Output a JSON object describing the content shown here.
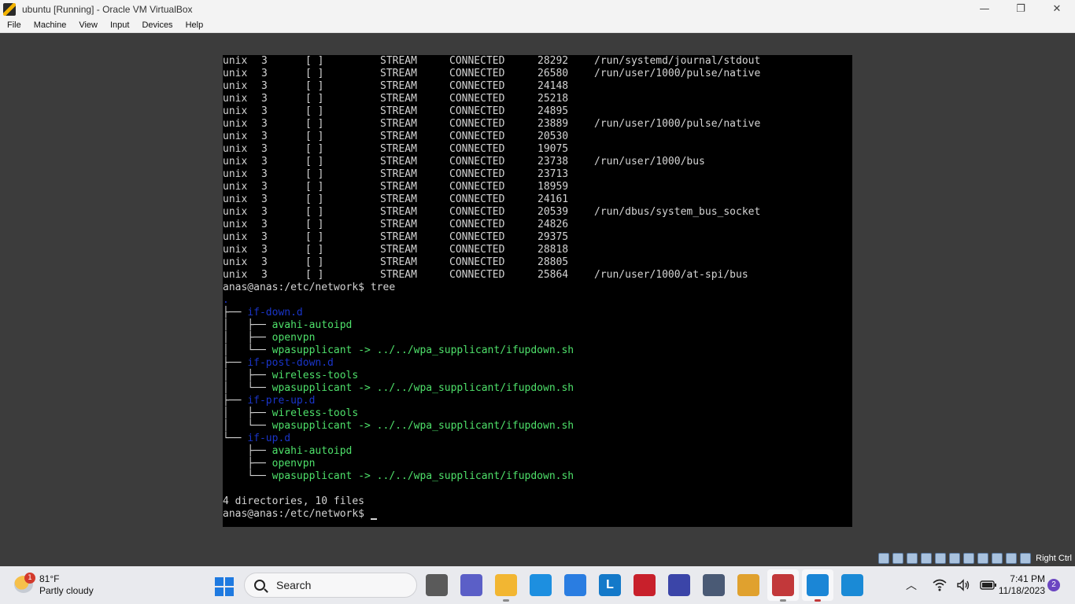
{
  "window": {
    "title": "ubuntu [Running] - Oracle VM VirtualBox",
    "minimize_glyph": "—",
    "maximize_glyph": "❐",
    "close_glyph": "✕"
  },
  "menubar": {
    "items": [
      "File",
      "Machine",
      "View",
      "Input",
      "Devices",
      "Help"
    ]
  },
  "terminal": {
    "netstat_rows": [
      {
        "proto": "unix",
        "refcnt": "3",
        "flags": "[ ]",
        "type": "STREAM",
        "state": "CONNECTED",
        "inode": "28292",
        "path": "/run/systemd/journal/stdout"
      },
      {
        "proto": "unix",
        "refcnt": "3",
        "flags": "[ ]",
        "type": "STREAM",
        "state": "CONNECTED",
        "inode": "26580",
        "path": "/run/user/1000/pulse/native"
      },
      {
        "proto": "unix",
        "refcnt": "3",
        "flags": "[ ]",
        "type": "STREAM",
        "state": "CONNECTED",
        "inode": "24148",
        "path": ""
      },
      {
        "proto": "unix",
        "refcnt": "3",
        "flags": "[ ]",
        "type": "STREAM",
        "state": "CONNECTED",
        "inode": "25218",
        "path": ""
      },
      {
        "proto": "unix",
        "refcnt": "3",
        "flags": "[ ]",
        "type": "STREAM",
        "state": "CONNECTED",
        "inode": "24895",
        "path": ""
      },
      {
        "proto": "unix",
        "refcnt": "3",
        "flags": "[ ]",
        "type": "STREAM",
        "state": "CONNECTED",
        "inode": "23889",
        "path": "/run/user/1000/pulse/native"
      },
      {
        "proto": "unix",
        "refcnt": "3",
        "flags": "[ ]",
        "type": "STREAM",
        "state": "CONNECTED",
        "inode": "20530",
        "path": ""
      },
      {
        "proto": "unix",
        "refcnt": "3",
        "flags": "[ ]",
        "type": "STREAM",
        "state": "CONNECTED",
        "inode": "19075",
        "path": ""
      },
      {
        "proto": "unix",
        "refcnt": "3",
        "flags": "[ ]",
        "type": "STREAM",
        "state": "CONNECTED",
        "inode": "23738",
        "path": "/run/user/1000/bus"
      },
      {
        "proto": "unix",
        "refcnt": "3",
        "flags": "[ ]",
        "type": "STREAM",
        "state": "CONNECTED",
        "inode": "23713",
        "path": ""
      },
      {
        "proto": "unix",
        "refcnt": "3",
        "flags": "[ ]",
        "type": "STREAM",
        "state": "CONNECTED",
        "inode": "18959",
        "path": ""
      },
      {
        "proto": "unix",
        "refcnt": "3",
        "flags": "[ ]",
        "type": "STREAM",
        "state": "CONNECTED",
        "inode": "24161",
        "path": ""
      },
      {
        "proto": "unix",
        "refcnt": "3",
        "flags": "[ ]",
        "type": "STREAM",
        "state": "CONNECTED",
        "inode": "20539",
        "path": "/run/dbus/system_bus_socket"
      },
      {
        "proto": "unix",
        "refcnt": "3",
        "flags": "[ ]",
        "type": "STREAM",
        "state": "CONNECTED",
        "inode": "24826",
        "path": ""
      },
      {
        "proto": "unix",
        "refcnt": "3",
        "flags": "[ ]",
        "type": "STREAM",
        "state": "CONNECTED",
        "inode": "29375",
        "path": ""
      },
      {
        "proto": "unix",
        "refcnt": "3",
        "flags": "[ ]",
        "type": "STREAM",
        "state": "CONNECTED",
        "inode": "28818",
        "path": ""
      },
      {
        "proto": "unix",
        "refcnt": "3",
        "flags": "[ ]",
        "type": "STREAM",
        "state": "CONNECTED",
        "inode": "28805",
        "path": ""
      },
      {
        "proto": "unix",
        "refcnt": "3",
        "flags": "[ ]",
        "type": "STREAM",
        "state": "CONNECTED",
        "inode": "25864",
        "path": "/run/user/1000/at-spi/bus"
      }
    ],
    "prompt": "anas@anas:/etc/network$ ",
    "tree_command": "tree",
    "tree_root": ".",
    "tree": [
      {
        "prefix": "├── ",
        "name": "if-down.d",
        "kind": "dir",
        "link": ""
      },
      {
        "prefix": "│   ├── ",
        "name": "avahi-autoipd",
        "kind": "file",
        "link": ""
      },
      {
        "prefix": "│   ├── ",
        "name": "openvpn",
        "kind": "file",
        "link": ""
      },
      {
        "prefix": "│   └── ",
        "name": "wpasupplicant",
        "kind": "file",
        "link": " -> ../../wpa_supplicant/ifupdown.sh"
      },
      {
        "prefix": "├── ",
        "name": "if-post-down.d",
        "kind": "dir",
        "link": ""
      },
      {
        "prefix": "│   ├── ",
        "name": "wireless-tools",
        "kind": "file",
        "link": ""
      },
      {
        "prefix": "│   └── ",
        "name": "wpasupplicant",
        "kind": "file",
        "link": " -> ../../wpa_supplicant/ifupdown.sh"
      },
      {
        "prefix": "├── ",
        "name": "if-pre-up.d",
        "kind": "dir",
        "link": ""
      },
      {
        "prefix": "│   ├── ",
        "name": "wireless-tools",
        "kind": "file",
        "link": ""
      },
      {
        "prefix": "│   └── ",
        "name": "wpasupplicant",
        "kind": "file",
        "link": " -> ../../wpa_supplicant/ifupdown.sh"
      },
      {
        "prefix": "└── ",
        "name": "if-up.d",
        "kind": "dir",
        "link": ""
      },
      {
        "prefix": "    ├── ",
        "name": "avahi-autoipd",
        "kind": "file",
        "link": ""
      },
      {
        "prefix": "    ├── ",
        "name": "openvpn",
        "kind": "file",
        "link": ""
      },
      {
        "prefix": "    └── ",
        "name": "wpasupplicant",
        "kind": "file",
        "link": " -> ../../wpa_supplicant/ifupdown.sh"
      }
    ],
    "summary": "4 directories, 10 files",
    "colors": {
      "background": "#000000",
      "text": "#d4d4d4",
      "dir": "#1a35c9",
      "file": "#4ee06a"
    }
  },
  "vbox_status": {
    "icons": [
      "hard-disk-icon",
      "optical-drive-icon",
      "audio-icon",
      "network-icon",
      "usb-icon",
      "shared-folders-icon",
      "display-icon",
      "recording-icon",
      "cpu-icon",
      "mouse-integration-icon",
      "keyboard-icon"
    ],
    "host_key_label": "Right Ctrl"
  },
  "taskbar": {
    "weather_badge": "1",
    "weather_temp": "81°F",
    "weather_desc": "Partly cloudy",
    "search_label": "Search",
    "apps": [
      {
        "name": "task-view",
        "glyph": "",
        "color": "#5a5a5a"
      },
      {
        "name": "chat",
        "glyph": "",
        "color": "#5b5fc7"
      },
      {
        "name": "file-explorer",
        "glyph": "",
        "color": "#f2b632"
      },
      {
        "name": "edge",
        "glyph": "",
        "color": "#1d8fe0"
      },
      {
        "name": "store",
        "glyph": "",
        "color": "#2a7de1"
      },
      {
        "name": "l-app",
        "glyph": "L",
        "color": "#1479c9"
      },
      {
        "name": "mcafee",
        "glyph": "",
        "color": "#c8202b"
      },
      {
        "name": "vpn",
        "glyph": "",
        "color": "#3b45a8"
      },
      {
        "name": "virtualbox-3d",
        "glyph": "",
        "color": "#4a5a75"
      },
      {
        "name": "tool-app",
        "glyph": "",
        "color": "#e0a12e"
      },
      {
        "name": "snipping-tool",
        "glyph": "",
        "color": "#c2383a"
      },
      {
        "name": "ubuntu-vm",
        "glyph": "",
        "color": "#1b86d6"
      },
      {
        "name": "photos",
        "glyph": "",
        "color": "#1a8ad6"
      }
    ],
    "tray": {
      "chevron": "^",
      "wifi": "wifi",
      "volume": "volume",
      "battery": "battery"
    },
    "time": "7:41 PM",
    "date": "11/18/2023",
    "notification_count": "2"
  }
}
